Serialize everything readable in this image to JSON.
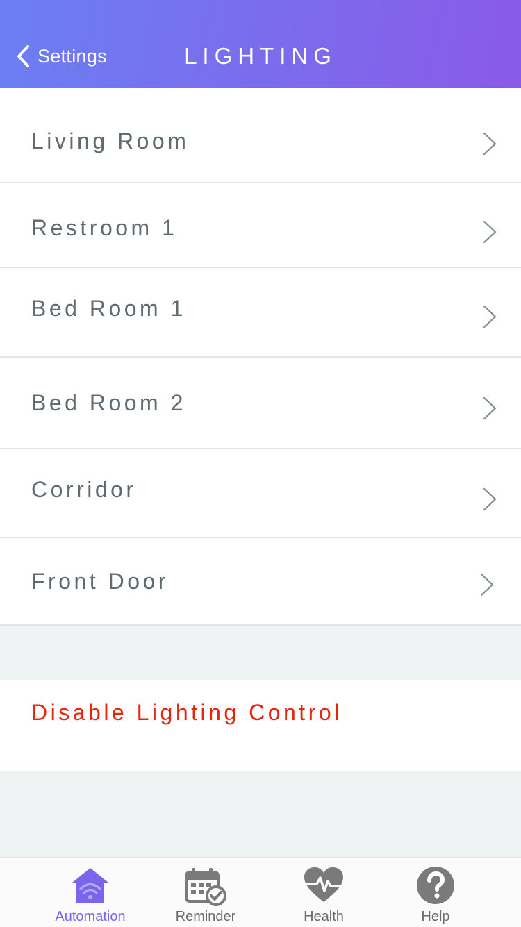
{
  "header": {
    "back_label": "Settings",
    "title": "LIGHTING",
    "gradient_start": "#6b7ff2",
    "gradient_end": "#8a5ae8"
  },
  "rooms": [
    {
      "label": "Living Room"
    },
    {
      "label": "Restroom 1"
    },
    {
      "label": "Bed Room 1"
    },
    {
      "label": "Bed Room 2"
    },
    {
      "label": "Corridor"
    },
    {
      "label": "Front Door"
    }
  ],
  "disable_action": {
    "label": "Disable Lighting Control",
    "color": "#e8230e"
  },
  "tabbar": {
    "active_color": "#7966ea",
    "inactive_color": "#6b6b6b",
    "tabs": [
      {
        "label": "Automation",
        "icon": "home-wifi-icon",
        "active": true
      },
      {
        "label": "Reminder",
        "icon": "calendar-check-icon",
        "active": false
      },
      {
        "label": "Health",
        "icon": "heart-pulse-icon",
        "active": false
      },
      {
        "label": "Help",
        "icon": "help-icon",
        "active": false
      }
    ]
  }
}
